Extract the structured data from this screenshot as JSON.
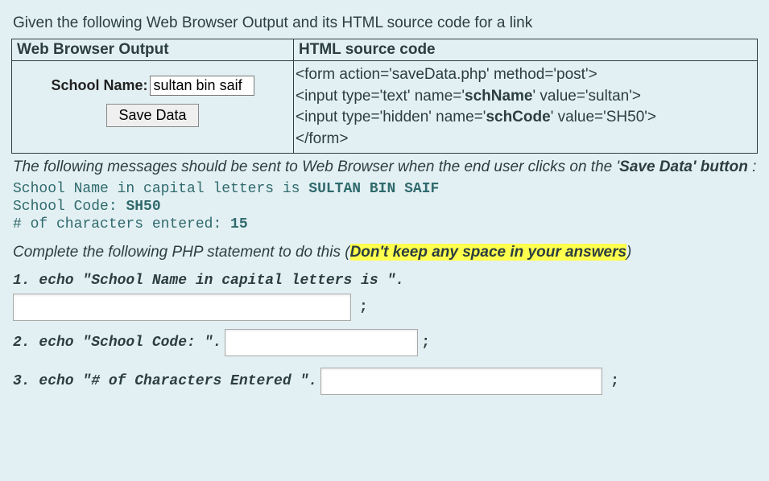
{
  "intro": "Given the following Web Browser Output and its HTML source code for a link",
  "headers": {
    "left": "Web Browser Output",
    "right": "HTML source code"
  },
  "form": {
    "label": "School Name:",
    "value": "sultan bin saif",
    "button": "Save Data"
  },
  "code": {
    "l1a": "<form action='saveData.php' method='post'>",
    "l2a": "<input type='text' name='",
    "l2b": "schName",
    "l2c": "' value='sultan'>",
    "l3a": "<input type='hidden' name='",
    "l3b": "schCode",
    "l3c": "' value='SH50'>",
    "l4a": "</form>"
  },
  "msg_intro_a": "The following messages should be sent to Web Browser when the end user clicks on the '",
  "msg_intro_b": "Save Data' button",
  "msg_intro_c": " :",
  "out": {
    "l1a": "School Name in capital letters is ",
    "l1b": "SULTAN BIN SAIF",
    "l2a": "School Code: ",
    "l2b": "SH50",
    "l3a": "# of characters entered: ",
    "l3b": "15"
  },
  "complete_a": "Complete the following PHP statement to do this (",
  "complete_b": "Don't keep any space in your answers",
  "complete_c": ")",
  "q1": "1. echo \"School Name in capital letters is \".",
  "q2": "2. echo \"School Code: \".",
  "q3": "3. echo \"# of Characters Entered \".",
  "semi": ";"
}
